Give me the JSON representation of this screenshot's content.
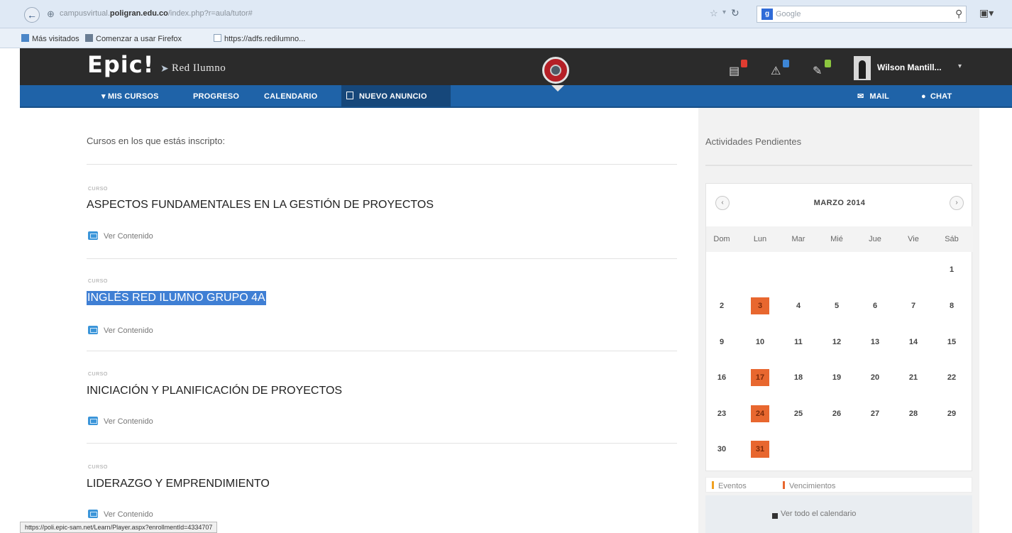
{
  "browser": {
    "url_prefix": "campusvirtual.",
    "url_domain": "poligran.edu.co",
    "url_path": "/index.php?r=aula/tutor#",
    "search_engine": "g",
    "search_placeholder": "Google",
    "back_icon": "back-arrow-icon",
    "bookmarks": [
      {
        "label": "Más visitados",
        "icon": "most-visited-icon"
      },
      {
        "label": "Comenzar a usar Firefox",
        "icon": "firefox-icon"
      },
      {
        "label": "https://adfs.redilumno...",
        "icon": "page-icon"
      }
    ],
    "status_url": "https://poli.epic-sam.net/Learn/Player.aspx?enrollmentId=4334707"
  },
  "header": {
    "logo": "Epic!",
    "logo_sub": "Red Ilumno",
    "user_name": "Wilson Mantill...",
    "icons": [
      {
        "name": "messages-icon",
        "badge_color": "#e03c31"
      },
      {
        "name": "alerts-icon",
        "badge_color": "#3d86d6"
      },
      {
        "name": "tasks-icon",
        "badge_color": "#8cc63f"
      }
    ]
  },
  "nav": {
    "items": [
      "▾ MIS CURSOS",
      "PROGRESO",
      "CALENDARIO",
      "NUEVO ANUNCIO"
    ],
    "mail": "MAIL",
    "chat": "CHAT"
  },
  "main": {
    "enrolled_title": "Cursos en los que estás inscripto:",
    "courses": [
      {
        "label": "CURSO",
        "title": "ASPECTOS FUNDAMENTALES EN LA GESTIÓN DE PROYECTOS",
        "link": "Ver Contenido",
        "selected": false
      },
      {
        "label": "CURSO",
        "title": "INGLÉS RED ILUMNO GRUPO 4A",
        "link": "Ver Contenido",
        "selected": true
      },
      {
        "label": "CURSO",
        "title": "INICIACIÓN Y PLANIFICACIÓN DE PROYECTOS",
        "link": "Ver Contenido",
        "selected": false
      },
      {
        "label": "CURSO",
        "title": "LIDERAZGO Y EMPRENDIMIENTO",
        "link": "Ver Contenido",
        "selected": false
      }
    ]
  },
  "sidebar": {
    "title": "Actividades Pendientes",
    "calendar": {
      "month": "MARZO 2014",
      "prev": "‹",
      "next": "›",
      "days_of_week": [
        "Dom",
        "Lun",
        "Mar",
        "Mié",
        "Jue",
        "Vie",
        "Sáb"
      ],
      "weeks": [
        [
          "",
          "",
          "",
          "",
          "",
          "",
          "1"
        ],
        [
          "2",
          "3",
          "4",
          "5",
          "6",
          "7",
          "8"
        ],
        [
          "9",
          "10",
          "11",
          "12",
          "13",
          "14",
          "15"
        ],
        [
          "16",
          "17",
          "18",
          "19",
          "20",
          "21",
          "22"
        ],
        [
          "23",
          "24",
          "25",
          "26",
          "27",
          "28",
          "29"
        ],
        [
          "30",
          "31",
          "",
          "",
          "",
          "",
          ""
        ]
      ],
      "highlighted": [
        "3",
        "17",
        "24",
        "31"
      ]
    },
    "legend": [
      {
        "label": "Eventos",
        "color": "#f0a020"
      },
      {
        "label": "Vencimientos",
        "color": "#e8672f"
      }
    ],
    "see_all": "Ver todo el calendario"
  },
  "colors": {
    "nav_blue": "#1f63a8",
    "header_dark": "#2b2b2b",
    "highlight_orange": "#e8672f",
    "selection_blue": "#3f7fd4"
  }
}
